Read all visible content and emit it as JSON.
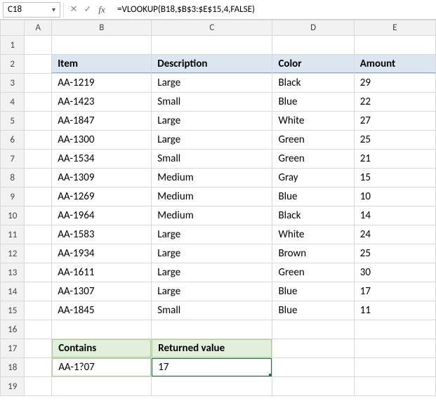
{
  "namebox": {
    "ref": "C18"
  },
  "formula_bar": {
    "value": "=VLOOKUP(B18,$B$3:$E$15,4,FALSE)"
  },
  "columns": [
    "",
    "A",
    "B",
    "C",
    "D",
    "E"
  ],
  "row_labels": [
    "1",
    "2",
    "3",
    "4",
    "5",
    "6",
    "7",
    "8",
    "9",
    "10",
    "11",
    "12",
    "13",
    "14",
    "15",
    "16",
    "17",
    "18",
    "19"
  ],
  "main_table": {
    "headers": {
      "item": "Item",
      "desc": "Description",
      "color": "Color",
      "amount": "Amount"
    },
    "rows": [
      {
        "item": "AA-1219",
        "desc": "Large",
        "color": "Black",
        "amount": "29"
      },
      {
        "item": "AA-1423",
        "desc": "Small",
        "color": "Blue",
        "amount": "22"
      },
      {
        "item": "AA-1847",
        "desc": "Large",
        "color": "White",
        "amount": "27"
      },
      {
        "item": "AA-1300",
        "desc": "Large",
        "color": "Green",
        "amount": "25"
      },
      {
        "item": "AA-1534",
        "desc": "Small",
        "color": "Green",
        "amount": "21"
      },
      {
        "item": "AA-1309",
        "desc": "Medium",
        "color": "Gray",
        "amount": "15"
      },
      {
        "item": "AA-1269",
        "desc": "Medium",
        "color": "Blue",
        "amount": "10"
      },
      {
        "item": "AA-1964",
        "desc": "Medium",
        "color": "Black",
        "amount": "14"
      },
      {
        "item": "AA-1583",
        "desc": "Large",
        "color": "White",
        "amount": "24"
      },
      {
        "item": "AA-1934",
        "desc": "Large",
        "color": "Brown",
        "amount": "25"
      },
      {
        "item": "AA-1611",
        "desc": "Large",
        "color": "Green",
        "amount": "30"
      },
      {
        "item": "AA-1307",
        "desc": "Large",
        "color": "Blue",
        "amount": "17"
      },
      {
        "item": "AA-1845",
        "desc": "Small",
        "color": "Blue",
        "amount": "11"
      }
    ]
  },
  "lookup": {
    "headers": {
      "contains": "Contains",
      "returned": "Returned value"
    },
    "row": {
      "contains": "AA-1?07",
      "returned": "17"
    }
  }
}
